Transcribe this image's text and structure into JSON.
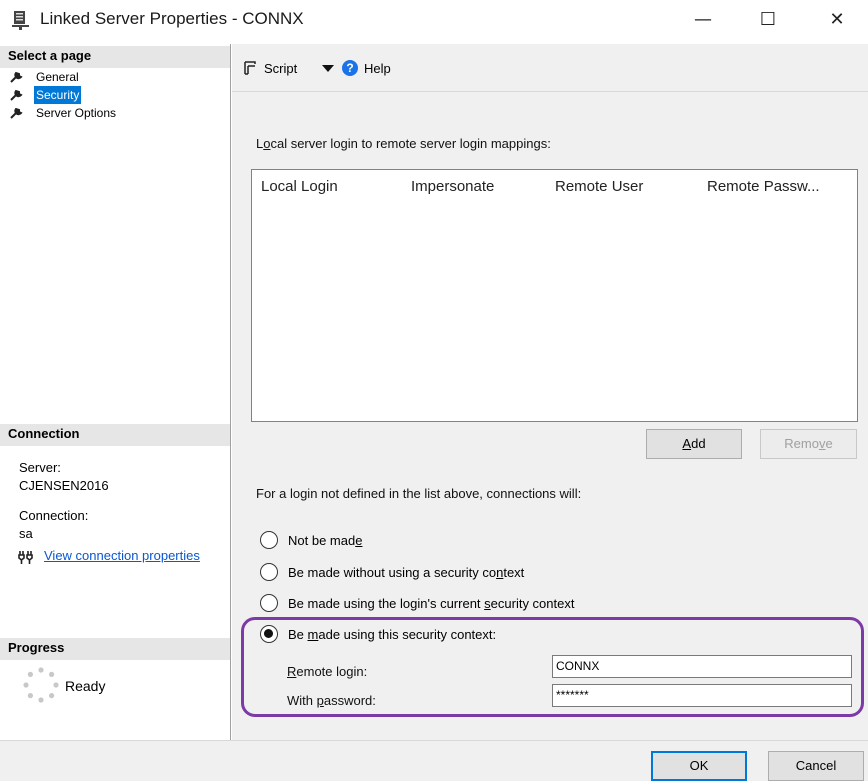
{
  "window": {
    "title": "Linked Server Properties - CONNX",
    "min_symbol": "—",
    "max_symbol": "☐",
    "close_symbol": "✕"
  },
  "left_pane": {
    "select_page_header": "Select a page",
    "pages": [
      {
        "label": "General",
        "icon": "wrench-icon",
        "selected": false
      },
      {
        "label": "Security",
        "icon": "wrench-icon",
        "selected": true
      },
      {
        "label": "Server Options",
        "icon": "wrench-icon",
        "selected": false
      }
    ],
    "connection_header": "Connection",
    "server_label": "Server:",
    "server_value": "CJENSEN2016",
    "connection_label": "Connection:",
    "connection_value": "sa",
    "view_link": "View connection properties",
    "progress_header": "Progress",
    "progress_status": "Ready"
  },
  "toolbar": {
    "script_label": "Script",
    "help_label": "Help"
  },
  "security": {
    "mappings_label_pre": "L",
    "mappings_label_u": "o",
    "mappings_label_post": "cal server login to remote server login mappings:",
    "columns": [
      "Local Login",
      "Impersonate",
      "Remote User",
      "Remote Passw..."
    ],
    "add_pre": "",
    "add_u": "A",
    "add_post": "dd",
    "remove_pre": "Remo",
    "remove_u": "v",
    "remove_post": "e",
    "not_defined_label": "For a login not defined in the list above, connections will:",
    "options": [
      {
        "pre": "Not be mad",
        "u": "e",
        "post": "",
        "selected": false
      },
      {
        "pre": "Be made without using a security co",
        "u": "n",
        "post": "text",
        "selected": false
      },
      {
        "pre": "Be made using the login's current ",
        "u": "s",
        "post": "ecurity context",
        "selected": false
      },
      {
        "pre": "Be ",
        "u": "m",
        "post": "ade using this security context:",
        "selected": true
      }
    ],
    "remote_login_pre": "",
    "remote_login_u": "R",
    "remote_login_post": "emote login:",
    "remote_login_value": "CONNX",
    "password_pre": "With ",
    "password_u": "p",
    "password_post": "assword:",
    "password_value": "*******"
  },
  "footer": {
    "ok_label": "OK",
    "cancel_label": "Cancel"
  },
  "colors": {
    "selection": "#0078d7",
    "highlight_border": "#7b3aa5",
    "link": "#0b57d0"
  }
}
